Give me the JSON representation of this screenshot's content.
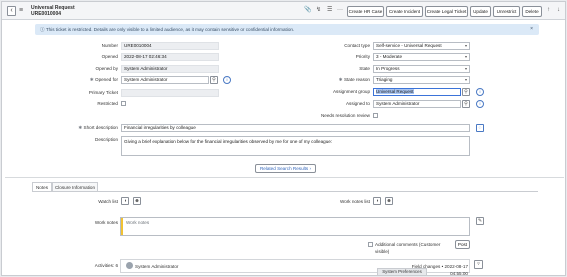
{
  "header": {
    "title": "Universal Request",
    "number": "URE0010004",
    "buttons": [
      "Create HR Case",
      "Create Incident",
      "Create Legal Ticket",
      "Update",
      "Unrestrict",
      "Delete"
    ],
    "icons": [
      "paperclip-icon",
      "activity-icon",
      "sliders-icon",
      "more-icon"
    ],
    "nav": [
      "↑",
      "↓"
    ]
  },
  "banner": {
    "text": "This ticket is restricted. Details are only visible to a limited audience, as it may contain sensitive or confidential information.",
    "close": "×"
  },
  "form": {
    "number_label": "Number",
    "number_value": "URE0010004",
    "opened_label": "Opened",
    "opened_value": "2022-08-17 02:46:34",
    "opened_by_label": "Opened by",
    "opened_by_value": "System Administrator",
    "opened_for_label": "Opened for",
    "opened_for_value": "System Administrator",
    "primary_ticket_label": "Primary Ticket",
    "primary_ticket_value": "",
    "restricted_label": "Restricted",
    "contact_type_label": "Contact type",
    "contact_type_value": "Self-service - Universal Request",
    "priority_label": "Priority",
    "priority_value": "3 - Moderate",
    "state_label": "State",
    "state_value": "In Progress",
    "state_reason_label": "State reason",
    "state_reason_value": "Triaging",
    "assignment_group_label": "Assignment group",
    "assignment_group_value": "Universal Request",
    "assigned_to_label": "Assigned to",
    "assigned_to_value": "System Administrator",
    "needs_review_label": "Needs resolution review",
    "short_description_label": "Short description",
    "short_description_value": "Financial irregularities by colleague",
    "description_label": "Description",
    "description_value": "Giving a brief explanation below for the financial irregularities observed by me for one of my colleague:"
  },
  "related_search": "Related Search Results",
  "tabs": [
    "Notes",
    "Closure Information"
  ],
  "notes": {
    "watch_list_label": "Watch list",
    "work_notes_list_label": "Work notes list",
    "work_notes_label": "Work notes",
    "work_notes_placeholder": "Work notes",
    "additional_comments_label": "Additional comments (Customer visible)",
    "post_label": "Post",
    "activities_label": "Activities: 6",
    "activity_author": "System Administrator",
    "activity_meta": "Field changes • 2022-08-17 04:55:00"
  },
  "toast": "System Preferences"
}
